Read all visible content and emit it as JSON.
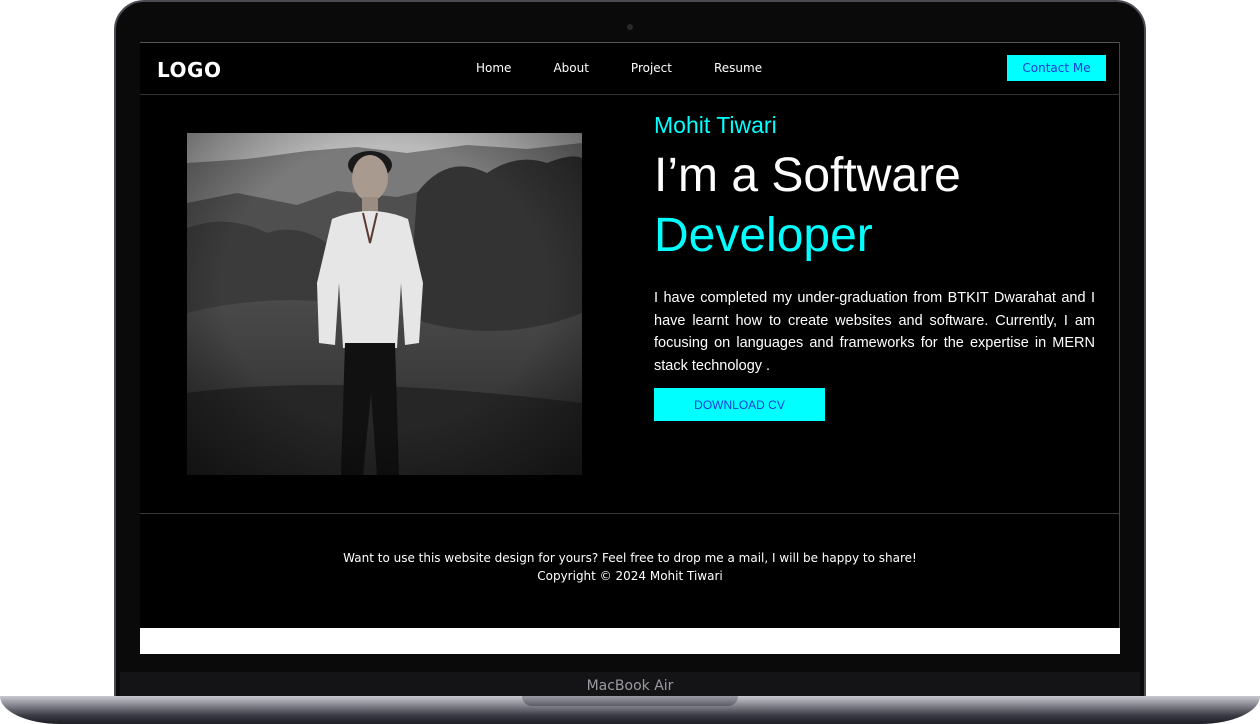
{
  "navbar": {
    "logo": "LOGO",
    "links": [
      "Home",
      "About",
      "Project",
      "Resume"
    ],
    "contact_label": "Contact Me"
  },
  "hero": {
    "name": "Mohit Tiwari",
    "headline_line1": "I’m a Software",
    "headline_line2": "Developer",
    "description": "I have completed my under-graduation from BTKIT Dwarahat and I have learnt how to create websites and software. Currently, I am focusing on languages and frameworks for the expertise in MERN stack technology .",
    "cta_label": "DOWNLOAD CV"
  },
  "footer": {
    "message": "Want to use this website design for yours? Feel free to drop me a mail, I will be happy to share!",
    "copyright": "Copyright © 2024 Mohit Tiwari"
  },
  "device": {
    "model_label": "MacBook Air"
  },
  "colors": {
    "accent": "#00ffff",
    "button_text": "#1a3bd6",
    "background": "#000000"
  }
}
